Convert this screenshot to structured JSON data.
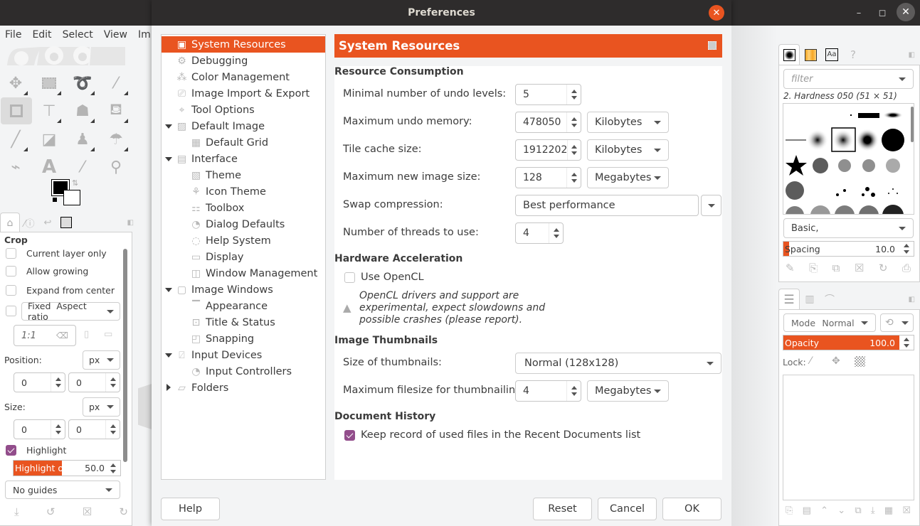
{
  "main_window": {
    "menu": [
      "File",
      "Edit",
      "Select",
      "View",
      "Im"
    ],
    "window_controls": {
      "minimize": "–",
      "maximize": "◻",
      "close": "✕"
    }
  },
  "toolbox": {
    "tools": [
      "move-tool",
      "rect-select-tool",
      "free-select-tool",
      "fuzzy-select-tool",
      "crop-tool",
      "unified-transform-tool",
      "warp-transform-tool",
      "bucket-fill-tool",
      "paintbrush-tool",
      "eraser-tool",
      "clone-tool",
      "smudge-tool",
      "paths-tool",
      "text-tool",
      "color-picker-tool",
      "zoom-tool"
    ],
    "fg_color": "#000000",
    "bg_color": "#ffffff"
  },
  "tool_options": {
    "title": "Crop",
    "current_layer_only": {
      "label": "Current layer only",
      "checked": false
    },
    "allow_growing": {
      "label": "Allow growing",
      "checked": false
    },
    "expand_from_center": {
      "label": "Expand from center",
      "checked": false
    },
    "fixed": {
      "checked": false,
      "mode": "Fixed",
      "value": "Aspect ratio"
    },
    "ratio": "1:1",
    "position_label": "Position:",
    "position_unit": "px",
    "position_x": "0",
    "position_y": "0",
    "size_label": "Size:",
    "size_unit": "px",
    "size_w": "0",
    "size_h": "0",
    "highlight": {
      "label": "Highlight",
      "checked": true
    },
    "highlight_opacity": {
      "label": "Highlight opa…",
      "value": "50.0",
      "fraction": 0.5
    },
    "guides": "No guides"
  },
  "dialog": {
    "title": "Preferences",
    "nav": [
      {
        "label": "System Resources",
        "level": 0,
        "selected": true
      },
      {
        "label": "Debugging",
        "level": 0
      },
      {
        "label": "Color Management",
        "level": 0
      },
      {
        "label": "Image Import & Export",
        "level": 0
      },
      {
        "label": "Tool Options",
        "level": 0
      },
      {
        "label": "Default Image",
        "level": 0,
        "expander": "down"
      },
      {
        "label": "Default Grid",
        "level": 1
      },
      {
        "label": "Interface",
        "level": 0,
        "expander": "down"
      },
      {
        "label": "Theme",
        "level": 1
      },
      {
        "label": "Icon Theme",
        "level": 1
      },
      {
        "label": "Toolbox",
        "level": 1
      },
      {
        "label": "Dialog Defaults",
        "level": 1
      },
      {
        "label": "Help System",
        "level": 1
      },
      {
        "label": "Display",
        "level": 1
      },
      {
        "label": "Window Management",
        "level": 1
      },
      {
        "label": "Image Windows",
        "level": 0,
        "expander": "down"
      },
      {
        "label": "Appearance",
        "level": 1
      },
      {
        "label": "Title & Status",
        "level": 1
      },
      {
        "label": "Snapping",
        "level": 1
      },
      {
        "label": "Input Devices",
        "level": 0,
        "expander": "down"
      },
      {
        "label": "Input Controllers",
        "level": 1
      },
      {
        "label": "Folders",
        "level": 0,
        "expander": "right"
      }
    ],
    "header": "System Resources",
    "sections": {
      "resource": "Resource Consumption",
      "hardware": "Hardware Acceleration",
      "thumbnails": "Image Thumbnails",
      "history": "Document History"
    },
    "fields": {
      "undo_levels": {
        "label": "Minimal number of undo levels:",
        "value": "5"
      },
      "undo_memory": {
        "label": "Maximum undo memory:",
        "value": "478050",
        "unit": "Kilobytes"
      },
      "tile_cache": {
        "label": "Tile cache size:",
        "value": "1912202",
        "unit": "Kilobytes"
      },
      "max_image": {
        "label": "Maximum new image size:",
        "value": "128",
        "unit": "Megabytes"
      },
      "swap": {
        "label": "Swap compression:",
        "value": "Best performance"
      },
      "threads": {
        "label": "Number of threads to use:",
        "value": "4"
      },
      "opencl": {
        "label": "Use OpenCL",
        "checked": false
      },
      "opencl_warning": "OpenCL drivers and support are experimental, expect slowdowns and possible crashes (please report).",
      "thumb_size": {
        "label": "Size of thumbnails:",
        "value": "Normal (128x128)"
      },
      "thumb_filesize": {
        "label": "Maximum filesize for thumbnailing:",
        "value": "4",
        "unit": "Megabytes"
      },
      "recent_docs": {
        "label": "Keep record of used files in the Recent Documents list",
        "checked": true
      }
    },
    "buttons": {
      "help": "Help",
      "reset": "Reset",
      "cancel": "Cancel",
      "ok": "OK"
    }
  },
  "brushes_dock": {
    "tab_text_icon": "Aa",
    "filter_placeholder": "filter",
    "brush_name": "2. Hardness 050 (51 × 51)",
    "tag": "Basic,",
    "spacing": {
      "label": "Spacing",
      "value": "10.0",
      "fraction": 0.1
    }
  },
  "layers_dock": {
    "mode_label": "Mode",
    "mode_value": "Normal",
    "opacity": {
      "label": "Opacity",
      "value": "100.0",
      "fraction": 1.0
    },
    "lock_label": "Lock:"
  },
  "colors": {
    "accent": "#e95420",
    "check": "#924d8b",
    "titlebar": "#2e2c2c"
  }
}
